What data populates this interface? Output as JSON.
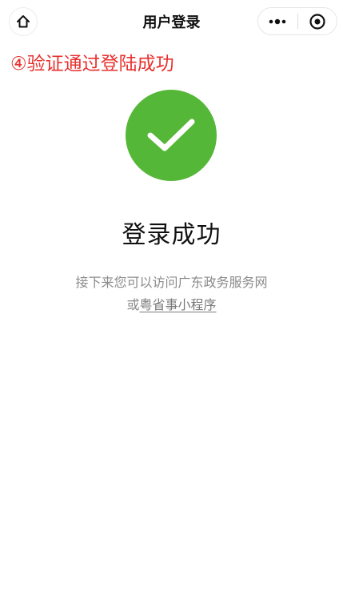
{
  "navbar": {
    "title": "用户登录",
    "home_icon": "home-icon",
    "more_icon": "more-dots-icon",
    "close_icon": "target-circle-icon"
  },
  "annotation": {
    "text": "④验证通过登陆成功",
    "color": "#e8312e"
  },
  "result": {
    "icon": "check-icon",
    "icon_bg": "#55b737",
    "title": "登录成功",
    "desc_line1": "接下来您可以访问广东政务服务网",
    "desc_prefix": "或",
    "desc_link": "粤省事小程序"
  }
}
